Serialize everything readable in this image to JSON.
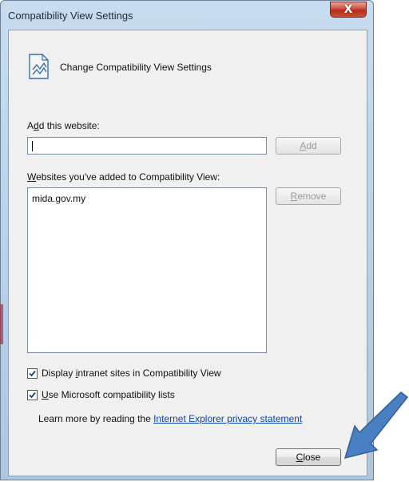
{
  "window": {
    "title": "Compatibility View Settings",
    "close_glyph": "X"
  },
  "header": {
    "icon": "compatibility-view-icon",
    "text": "Change Compatibility View Settings"
  },
  "add_website": {
    "label_prefix": "A",
    "label_mnemonic": "d",
    "label_suffix": "d this website:",
    "value": "",
    "add_button_prefix": "",
    "add_button_mnemonic": "A",
    "add_button_suffix": "dd"
  },
  "websites_list": {
    "label_mnemonic": "W",
    "label_suffix": "ebsites you've added to Compatibility View:",
    "items": [
      "mida.gov.my"
    ],
    "remove_button_mnemonic": "R",
    "remove_button_suffix": "emove"
  },
  "options": {
    "intranet_prefix": "Display ",
    "intranet_mnemonic": "i",
    "intranet_suffix": "ntranet sites in Compatibility View",
    "intranet_checked": true,
    "ms_lists_mnemonic": "U",
    "ms_lists_suffix": "se Microsoft compatibility lists",
    "ms_lists_checked": true
  },
  "learn_more": {
    "text": "Learn more by reading the ",
    "link": "Internet Explorer privacy statement"
  },
  "footer": {
    "close_mnemonic": "C",
    "close_suffix": "lose"
  },
  "colors": {
    "arrow": "#4a7fc1",
    "link": "#0645ad"
  }
}
